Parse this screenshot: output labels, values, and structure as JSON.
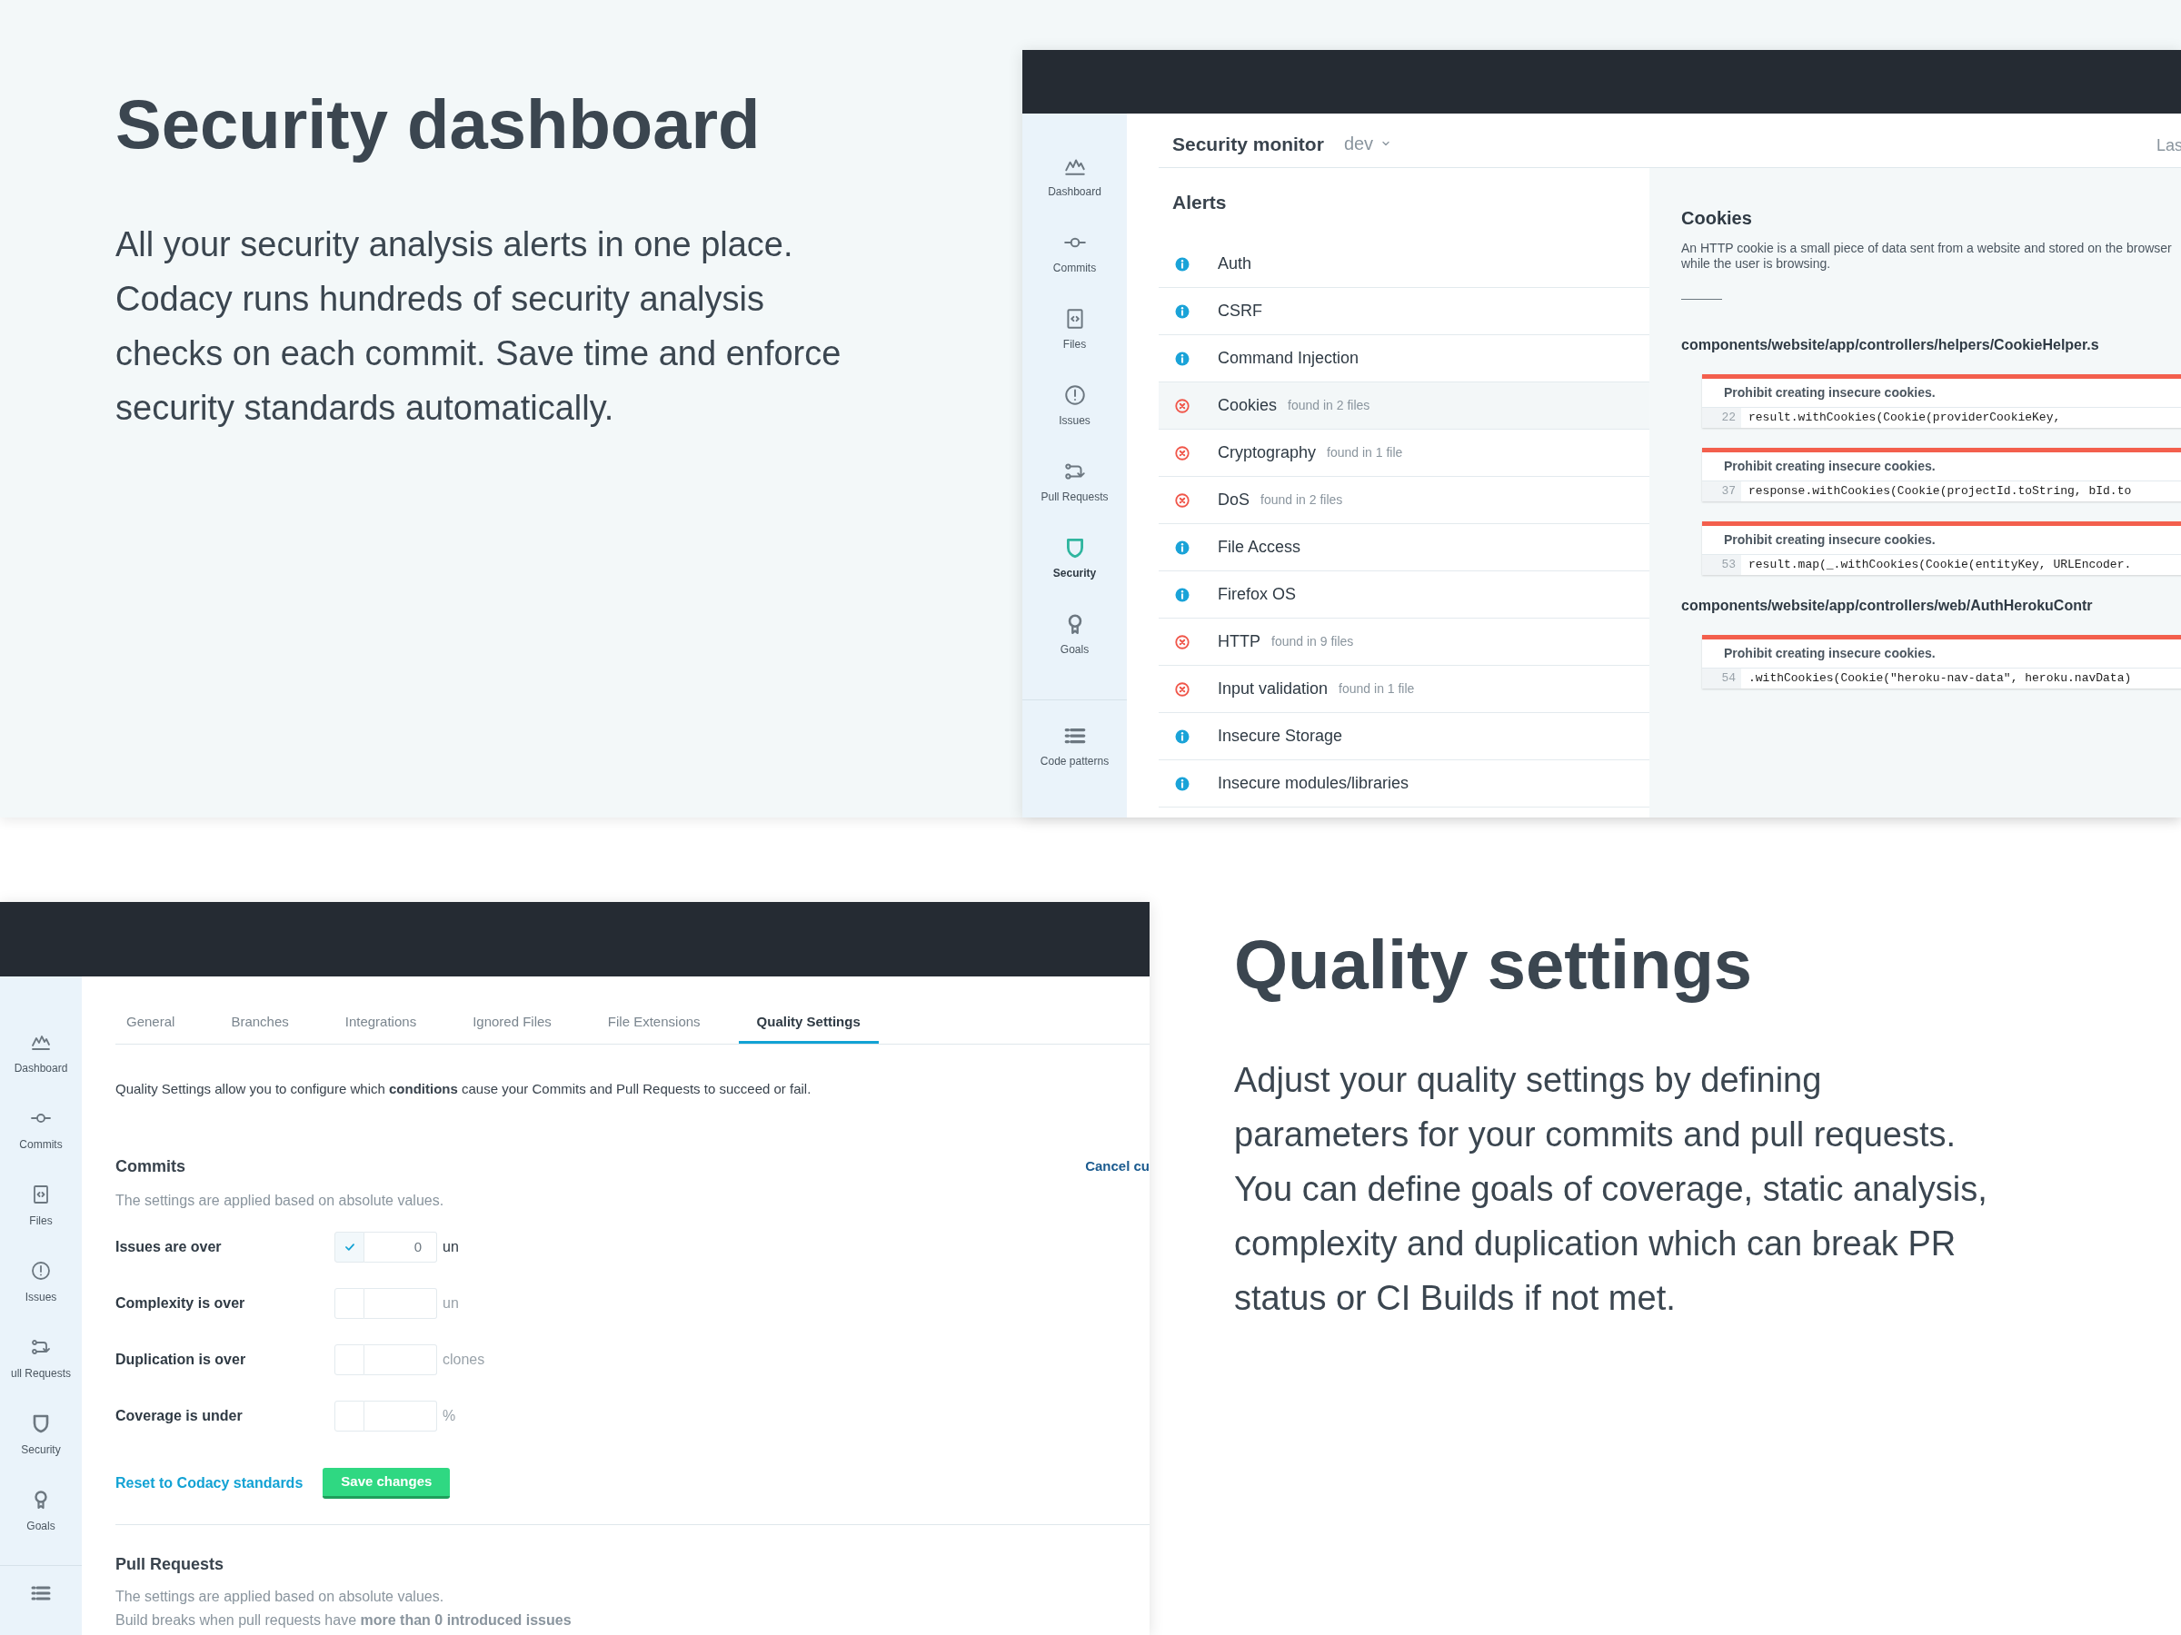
{
  "security_section": {
    "heading": "Security dashboard",
    "body": "All your security analysis alerts in one place. Codacy runs hundreds of security analysis checks on each commit. Save time and enforce security standards automatically."
  },
  "security_app": {
    "sidebar": [
      {
        "label": "Dashboard",
        "selected": false
      },
      {
        "label": "Commits",
        "selected": false
      },
      {
        "label": "Files",
        "selected": false
      },
      {
        "label": "Issues",
        "selected": false
      },
      {
        "label": "Pull Requests",
        "selected": false
      },
      {
        "label": "Security",
        "selected": true
      },
      {
        "label": "Goals",
        "selected": false
      },
      {
        "label": "Code patterns",
        "selected": false
      }
    ],
    "header": {
      "title": "Security monitor",
      "branch": "dev",
      "right_text": "Las"
    },
    "alerts": {
      "title": "Alerts",
      "items": [
        {
          "kind": "info",
          "name": "Auth",
          "selected": false
        },
        {
          "kind": "info",
          "name": "CSRF",
          "selected": false
        },
        {
          "kind": "info",
          "name": "Command Injection",
          "selected": false
        },
        {
          "kind": "error",
          "name": "Cookies",
          "detail": "found in 2 files",
          "selected": true
        },
        {
          "kind": "error",
          "name": "Cryptography",
          "detail": "found in 1 file",
          "selected": false
        },
        {
          "kind": "error",
          "name": "DoS",
          "detail": "found in 2 files",
          "selected": false
        },
        {
          "kind": "info",
          "name": "File Access",
          "selected": false
        },
        {
          "kind": "info",
          "name": "Firefox OS",
          "selected": false
        },
        {
          "kind": "error",
          "name": "HTTP",
          "detail": "found in 9 files",
          "selected": false
        },
        {
          "kind": "error",
          "name": "Input validation",
          "detail": "found in 1 file",
          "selected": false
        },
        {
          "kind": "info",
          "name": "Insecure Storage",
          "selected": false
        },
        {
          "kind": "info",
          "name": "Insecure modules/libraries",
          "selected": false
        }
      ]
    },
    "detail": {
      "title": "Cookies",
      "description": "An HTTP cookie is a small piece of data sent from a website and stored on the browser while the user is browsing.",
      "files": [
        {
          "path": "components/website/app/controllers/helpers/CookieHelper.s",
          "issues": [
            {
              "message": "Prohibit creating insecure cookies.",
              "line": "22",
              "code": "result.withCookies(Cookie(providerCookieKey,"
            },
            {
              "message": "Prohibit creating insecure cookies.",
              "line": "37",
              "code": "response.withCookies(Cookie(projectId.toString, bId.to"
            },
            {
              "message": "Prohibit creating insecure cookies.",
              "line": "53",
              "code": "result.map(_.withCookies(Cookie(entityKey, URLEncoder."
            }
          ]
        },
        {
          "path": "components/website/app/controllers/web/AuthHerokuContr",
          "issues": [
            {
              "message": "Prohibit creating insecure cookies.",
              "line": "54",
              "code": ".withCookies(Cookie(\"heroku-nav-data\", heroku.navData)"
            }
          ]
        }
      ]
    }
  },
  "quality_section": {
    "heading": "Quality settings",
    "body": "Adjust your quality settings by defining parameters for your commits and pull requests. You can define goals of coverage, static analysis, complexity and duplication which can break PR status or CI Builds if not met."
  },
  "settings_app": {
    "sidebar": [
      {
        "label": "Dashboard",
        "selected": false
      },
      {
        "label": "Commits",
        "selected": false
      },
      {
        "label": "Files",
        "selected": false
      },
      {
        "label": "Issues",
        "selected": false
      },
      {
        "label": "ull Requests",
        "selected": false
      },
      {
        "label": "Security",
        "selected": false
      },
      {
        "label": "Goals",
        "selected": false
      }
    ],
    "tabs": [
      {
        "label": "General",
        "selected": false
      },
      {
        "label": "Branches",
        "selected": false
      },
      {
        "label": "Integrations",
        "selected": false
      },
      {
        "label": "Ignored Files",
        "selected": false
      },
      {
        "label": "File Extensions",
        "selected": false
      },
      {
        "label": "Quality Settings",
        "selected": true
      }
    ],
    "intro": "Quality Settings allow you to configure which **conditions** cause your Commits and Pull Requests to succeed or fail.",
    "commits": {
      "title": "Commits",
      "subtitle": "The settings are applied based on absolute values.",
      "cancel_link": "Cancel cu",
      "rules": [
        {
          "label": "Issues are over",
          "checked": true,
          "value": "0",
          "unit": "un"
        },
        {
          "label": "Complexity is over",
          "checked": false,
          "unit": "un"
        },
        {
          "label": "Duplication is over",
          "checked": false,
          "unit": "clones"
        },
        {
          "label": "Coverage is under",
          "checked": false,
          "unit": "%"
        }
      ],
      "reset_link": "Reset to Codacy standards",
      "save_button": "Save changes"
    },
    "pull_requests": {
      "title": "Pull Requests",
      "subtitle": "The settings are applied based on absolute values.",
      "note": "Build breaks when pull requests have **more than 0 introduced issues**"
    }
  }
}
